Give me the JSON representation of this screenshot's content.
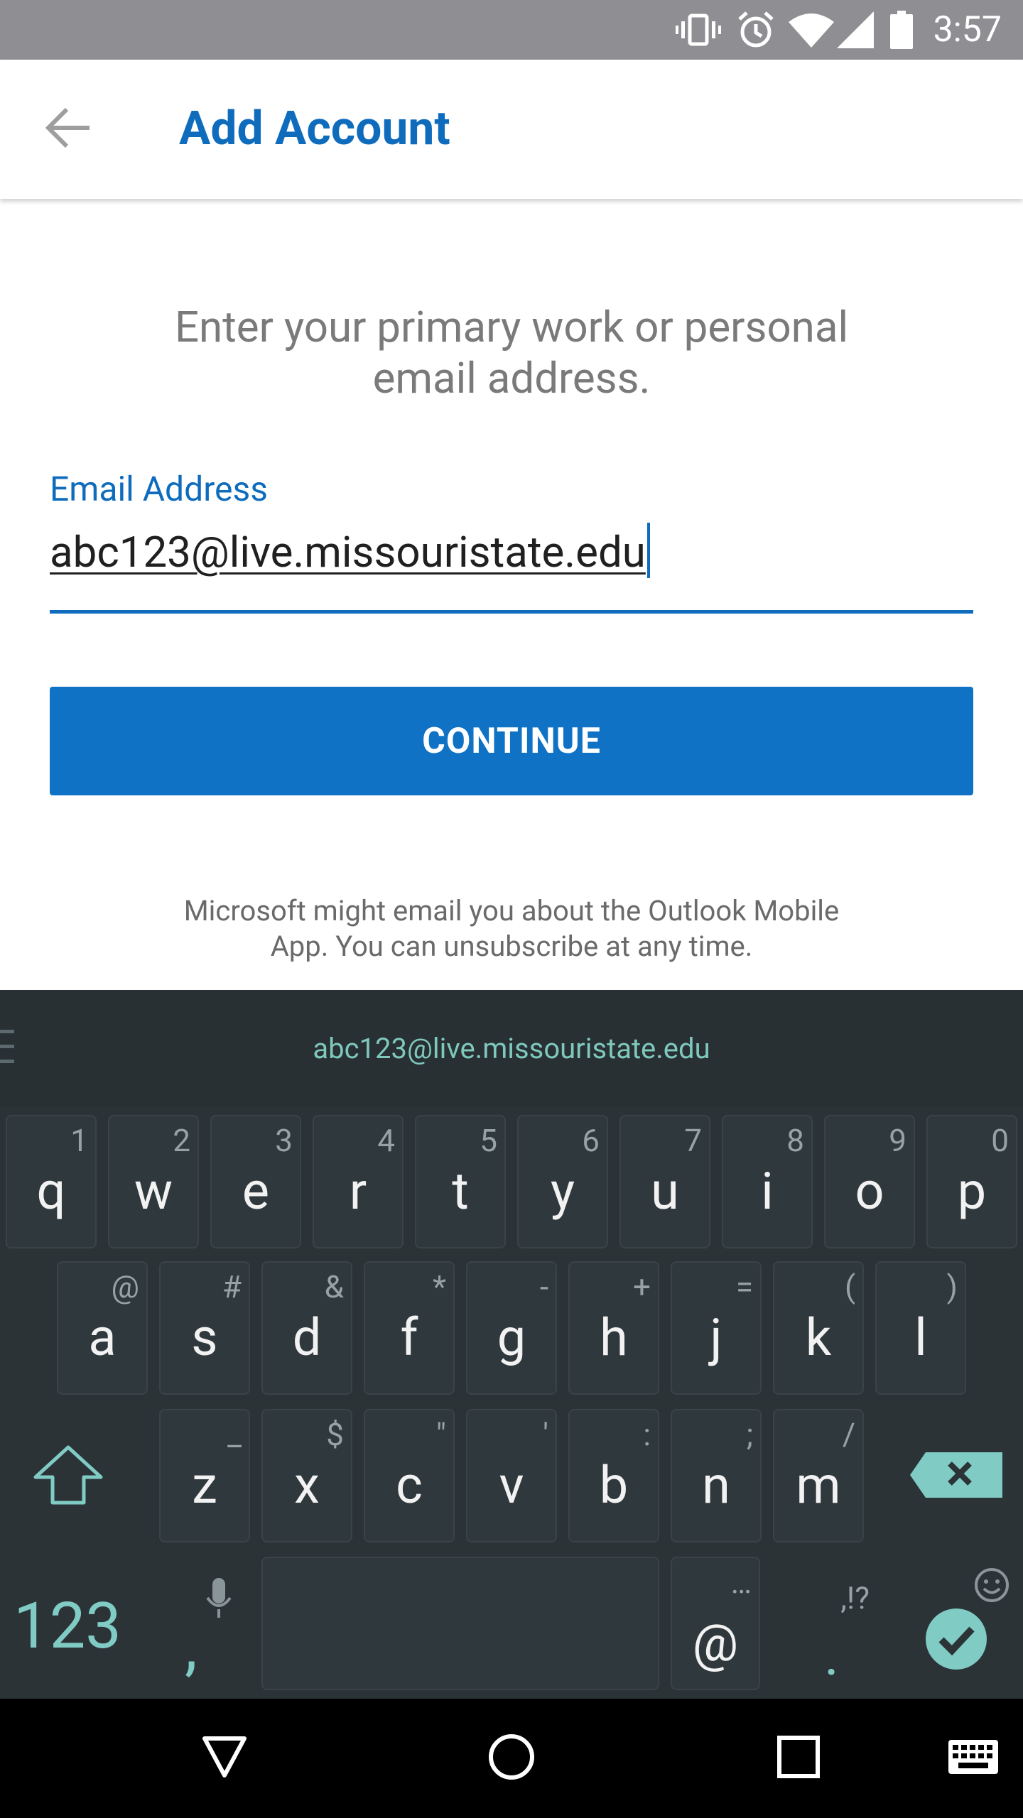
{
  "status_bar": {
    "time": "3:57",
    "icons": [
      "vibrate-icon",
      "alarm-icon",
      "wifi-icon",
      "signal-icon",
      "battery-icon"
    ]
  },
  "app_bar": {
    "title": "Add Account",
    "back_icon": "arrow-back-icon"
  },
  "form": {
    "instruction_line1": "Enter your primary work or personal",
    "instruction_line2": "email address.",
    "email_label": "Email Address",
    "email_value": "abc123@live.missouristate.edu",
    "continue_label": "CONTINUE",
    "disclaimer_line1": "Microsoft might email you about the Outlook Mobile",
    "disclaimer_line2": "App. You can unsubscribe at any time."
  },
  "keyboard": {
    "suggestion": "abc123@live.missouristate.edu",
    "row1": [
      {
        "key": "q",
        "hint": "1"
      },
      {
        "key": "w",
        "hint": "2"
      },
      {
        "key": "e",
        "hint": "3"
      },
      {
        "key": "r",
        "hint": "4"
      },
      {
        "key": "t",
        "hint": "5"
      },
      {
        "key": "y",
        "hint": "6"
      },
      {
        "key": "u",
        "hint": "7"
      },
      {
        "key": "i",
        "hint": "8"
      },
      {
        "key": "o",
        "hint": "9"
      },
      {
        "key": "p",
        "hint": "0"
      }
    ],
    "row2": [
      {
        "key": "a",
        "hint": "@"
      },
      {
        "key": "s",
        "hint": "#"
      },
      {
        "key": "d",
        "hint": "&"
      },
      {
        "key": "f",
        "hint": "*"
      },
      {
        "key": "g",
        "hint": "-"
      },
      {
        "key": "h",
        "hint": "+"
      },
      {
        "key": "j",
        "hint": "="
      },
      {
        "key": "k",
        "hint": "("
      },
      {
        "key": "l",
        "hint": ")"
      }
    ],
    "row3": [
      {
        "key": "z",
        "hint": "_"
      },
      {
        "key": "x",
        "hint": "$"
      },
      {
        "key": "c",
        "hint": "\""
      },
      {
        "key": "v",
        "hint": "'"
      },
      {
        "key": "b",
        "hint": ":"
      },
      {
        "key": "n",
        "hint": ";"
      },
      {
        "key": "m",
        "hint": "/"
      }
    ],
    "symbols_label": "123",
    "comma_label": ",",
    "at_label": "@",
    "at_hint": "…",
    "period_label": ".",
    "period_hint": ",!?",
    "accent_color": "#80cbc4"
  },
  "nav_bar": {
    "icons": [
      "back-triangle-icon",
      "home-circle-icon",
      "recents-square-icon",
      "keyboard-icon"
    ]
  }
}
